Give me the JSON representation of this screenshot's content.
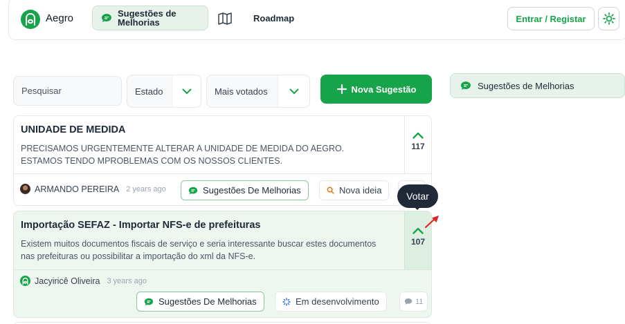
{
  "header": {
    "brand": "Aegro",
    "nav_active_line1": "Sugestões de",
    "nav_active_line2": "Melhorias",
    "roadmap": "Roadmap",
    "login": "Entrar / Registar"
  },
  "filters": {
    "search_placeholder": "Pesquisar",
    "state_label": "Estado",
    "sort_label": "Mais votados",
    "new_button": "Nova Sugestão"
  },
  "sidebar": {
    "category": "Sugestões de Melhorias"
  },
  "posts": [
    {
      "title": "UNIDADE DE MEDIDA",
      "description": "PRECISAMOS URGENTEMENTE ALTERAR A UNIDADE DE MEDIDA DO AEGRO. ESTAMOS TENDO MPROBLEMAS COM OS NOSSOS CLIENTES.",
      "votes": "117",
      "author": "ARMANDO PEREIRA",
      "time": "2 years ago",
      "category": "Sugestões De Melhorias",
      "status": "Nova ideia"
    },
    {
      "title": "Importação SEFAZ - Importar NFS-e de prefeituras",
      "description": "Existem muitos documentos fiscais de serviço e seria interessante buscar estes documentos nas prefeituras ou possibilitar a importação do xml da NFS-e.",
      "votes": "107",
      "author": "Jacyiricê Oliveira",
      "time": "3 years ago",
      "category": "Sugestões De Melhorias",
      "status": "Em desenvolvimento",
      "comments": "11"
    }
  ],
  "tooltip": "Votar",
  "colors": {
    "accent": "#16a34a",
    "active_bg": "#e7f3ea",
    "highlight_card": "#eef6f0",
    "tooltip_bg": "#1f2937"
  }
}
